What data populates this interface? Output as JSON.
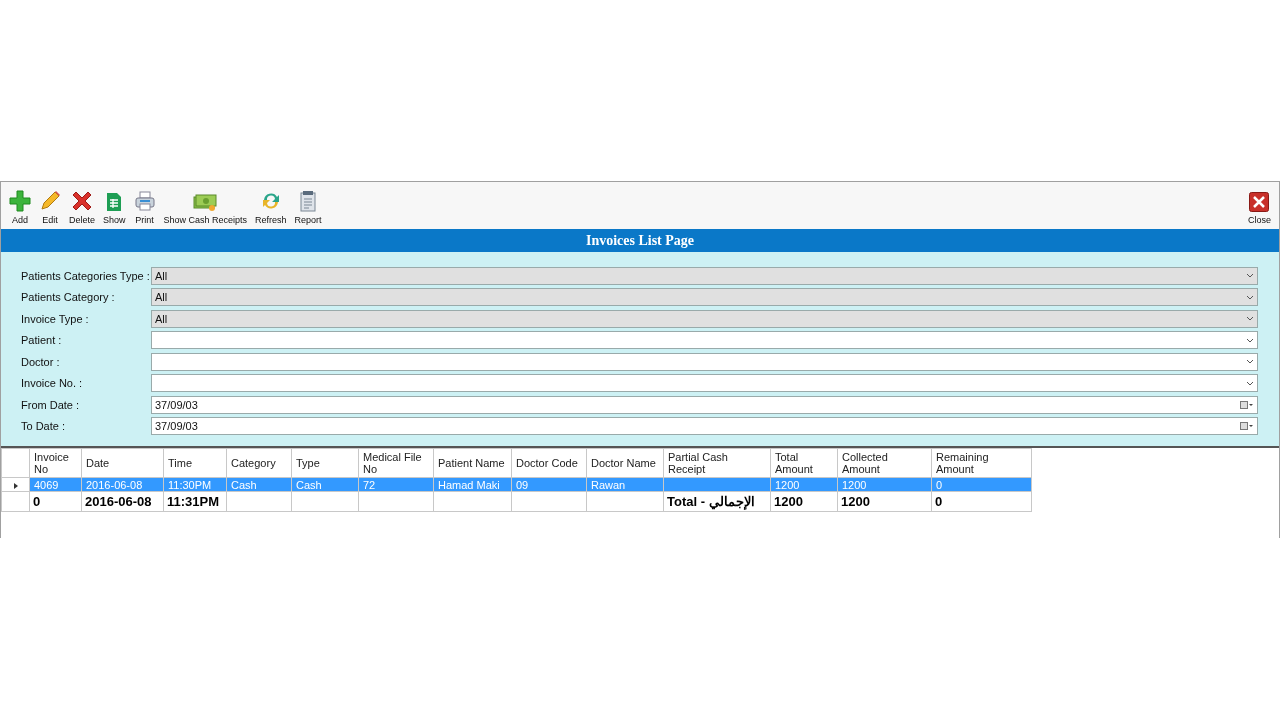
{
  "toolbar": {
    "buttons": [
      {
        "label": "Add"
      },
      {
        "label": "Edit"
      },
      {
        "label": "Delete"
      },
      {
        "label": "Show"
      },
      {
        "label": "Print"
      },
      {
        "label": "Show Cash Receipts"
      },
      {
        "label": "Refresh"
      },
      {
        "label": "Report"
      }
    ],
    "close": {
      "label": "Close"
    }
  },
  "title": "Invoices List Page",
  "filters": [
    {
      "label": "Patients Categories Type :",
      "kind": "select",
      "value": "All"
    },
    {
      "label": "Patients Category :",
      "kind": "select",
      "value": "All"
    },
    {
      "label": "Invoice Type :",
      "kind": "select",
      "value": "All"
    },
    {
      "label": "Patient :",
      "kind": "combo"
    },
    {
      "label": "Doctor :",
      "kind": "combo"
    },
    {
      "label": "Invoice No. :",
      "kind": "combo"
    },
    {
      "label": "From Date :",
      "kind": "date",
      "value": "37/09/03"
    },
    {
      "label": "To Date :",
      "kind": "date",
      "value": "37/09/03"
    }
  ],
  "table": {
    "columns": [
      "Invoice No",
      "Date",
      "Time",
      "Category",
      "Type",
      "Medical File No",
      "Patient Name",
      "Doctor Code",
      "Doctor Name",
      "Partial Cash Receipt",
      "Total Amount",
      "Collected Amount",
      "Remaining Amount"
    ],
    "rows": [
      {
        "kind": "data",
        "selected": true,
        "cells": [
          "4069",
          "2016-06-08",
          "11:30PM",
          "Cash",
          "Cash",
          "72",
          "Hamad Maki",
          "09",
          "Rawan",
          "",
          "1200",
          "1200",
          "0"
        ]
      },
      {
        "kind": "total",
        "selected": false,
        "cells": [
          "0",
          "2016-06-08",
          "11:31PM",
          "",
          "",
          "",
          "",
          "",
          "",
          "Total - الإجمالي",
          "1200",
          "1200",
          "0"
        ]
      }
    ]
  }
}
